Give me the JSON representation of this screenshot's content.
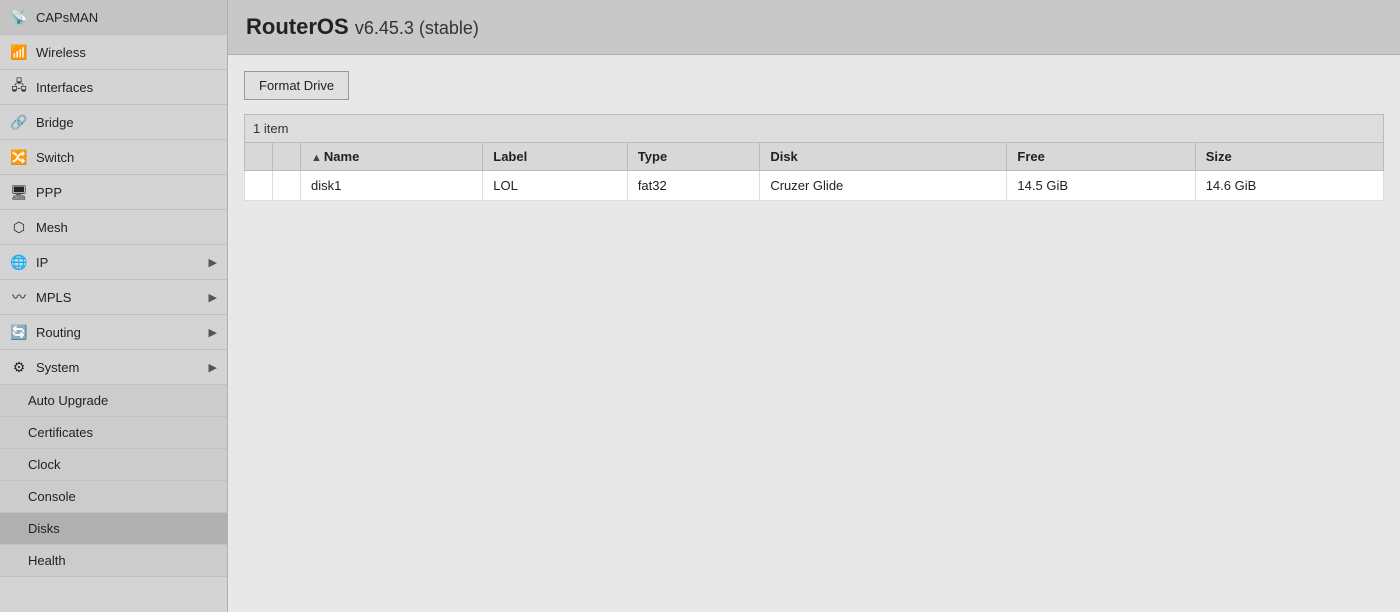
{
  "header": {
    "app_name": "RouterOS",
    "version": "v6.45.3 (stable)"
  },
  "sidebar": {
    "items": [
      {
        "id": "capsman",
        "label": "CAPsMAN",
        "icon": "📡",
        "indent": false,
        "active": false,
        "arrow": false
      },
      {
        "id": "wireless",
        "label": "Wireless",
        "icon": "📶",
        "indent": false,
        "active": false,
        "arrow": false
      },
      {
        "id": "interfaces",
        "label": "Interfaces",
        "icon": "🖧",
        "indent": false,
        "active": false,
        "arrow": false
      },
      {
        "id": "bridge",
        "label": "Bridge",
        "icon": "🔗",
        "indent": true,
        "active": false,
        "arrow": false
      },
      {
        "id": "switch",
        "label": "Switch",
        "icon": "🔀",
        "indent": true,
        "active": false,
        "arrow": false
      },
      {
        "id": "ppp",
        "label": "PPP",
        "icon": "🖥",
        "indent": false,
        "active": false,
        "arrow": false
      },
      {
        "id": "mesh",
        "label": "Mesh",
        "icon": "⬡",
        "indent": false,
        "active": false,
        "arrow": false
      },
      {
        "id": "ip",
        "label": "IP",
        "icon": "🌐",
        "indent": false,
        "active": false,
        "arrow": true
      },
      {
        "id": "mpls",
        "label": "MPLS",
        "icon": "〰",
        "indent": false,
        "active": false,
        "arrow": true
      },
      {
        "id": "routing",
        "label": "Routing",
        "icon": "🔄",
        "indent": false,
        "active": false,
        "arrow": true
      },
      {
        "id": "system",
        "label": "System",
        "icon": "⚙",
        "indent": false,
        "active": false,
        "arrow": true
      },
      {
        "id": "auto-upgrade",
        "label": "Auto Upgrade",
        "icon": "",
        "indent": true,
        "active": false,
        "arrow": false
      },
      {
        "id": "certificates",
        "label": "Certificates",
        "icon": "",
        "indent": true,
        "active": false,
        "arrow": false
      },
      {
        "id": "clock",
        "label": "Clock",
        "icon": "",
        "indent": true,
        "active": false,
        "arrow": false
      },
      {
        "id": "console",
        "label": "Console",
        "icon": "",
        "indent": true,
        "active": false,
        "arrow": false
      },
      {
        "id": "disks",
        "label": "Disks",
        "icon": "",
        "indent": true,
        "active": true,
        "arrow": false
      },
      {
        "id": "health",
        "label": "Health",
        "icon": "",
        "indent": true,
        "active": false,
        "arrow": false
      }
    ]
  },
  "toolbar": {
    "format_drive_label": "Format Drive"
  },
  "table": {
    "item_count": "1 item",
    "columns": [
      {
        "id": "check",
        "label": ""
      },
      {
        "id": "dot",
        "label": ""
      },
      {
        "id": "name",
        "label": "Name",
        "sorted": true
      },
      {
        "id": "label",
        "label": "Label"
      },
      {
        "id": "type",
        "label": "Type"
      },
      {
        "id": "disk",
        "label": "Disk"
      },
      {
        "id": "free",
        "label": "Free"
      },
      {
        "id": "size",
        "label": "Size"
      }
    ],
    "rows": [
      {
        "check": "",
        "dot": "",
        "name": "disk1",
        "label": "LOL",
        "type": "fat32",
        "disk": "Cruzer Glide",
        "free": "14.5 GiB",
        "size": "14.6 GiB"
      }
    ]
  }
}
